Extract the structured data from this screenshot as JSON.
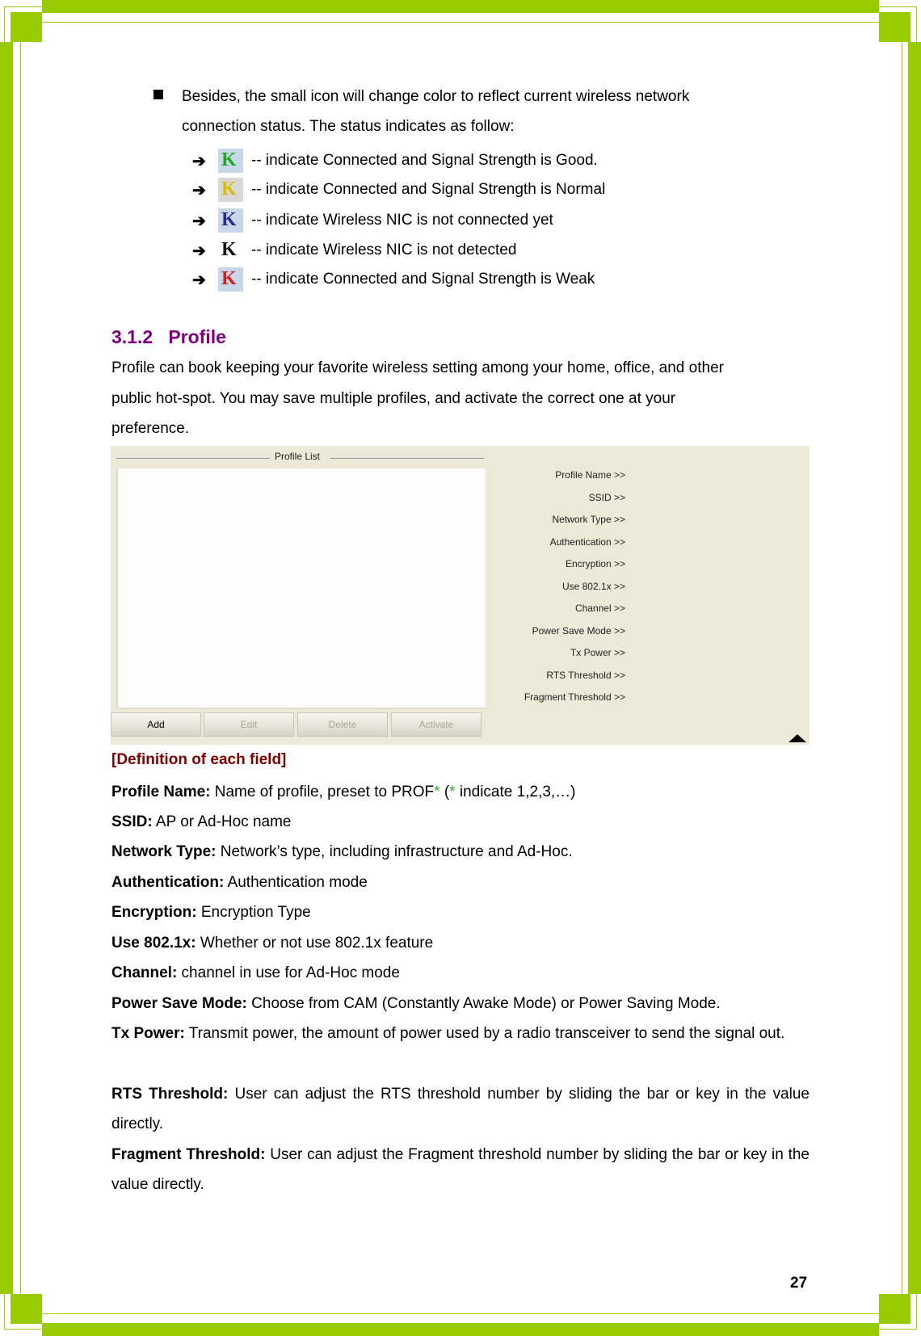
{
  "bullet": {
    "line1": "Besides, the small icon will change color to reflect current wireless network",
    "line2": "connection status. The status indicates as follow:"
  },
  "status_items": [
    {
      "icon": "tray-icon-green",
      "color": "#22aa22",
      "text": "-- indicate Connected and Signal Strength is Good."
    },
    {
      "icon": "tray-icon-yellow",
      "color": "#ddbb00",
      "text": "-- indicate Connected and Signal Strength is Normal"
    },
    {
      "icon": "tray-icon-blue-red",
      "color": "#2a2a90",
      "text": "-- indicate Wireless NIC is not connected yet"
    },
    {
      "icon": "tray-icon-black",
      "color": "#111111",
      "text": "-- indicate Wireless NIC is not detected"
    },
    {
      "icon": "tray-icon-red",
      "color": "#cc2222",
      "text": "-- indicate Connected and Signal Strength is Weak"
    }
  ],
  "section": {
    "number": "3.1.2",
    "title": "Profile",
    "intro": [
      "Profile can book keeping your favorite wireless setting among your home, office, and other",
      "public hot-spot. You may save multiple profiles, and activate the correct one at your",
      "preference."
    ]
  },
  "screenshot": {
    "list_title": "Profile List",
    "buttons": [
      {
        "label": "Add",
        "enabled": true
      },
      {
        "label": "Edit",
        "enabled": false
      },
      {
        "label": "Delete",
        "enabled": false
      },
      {
        "label": "Activate",
        "enabled": false
      }
    ],
    "fields": [
      "Profile Name >>",
      "SSID >>",
      "Network Type >>",
      "Authentication >>",
      "Encryption >>",
      "Use 802.1x >>",
      "Channel >>",
      "Power Save Mode >>",
      "Tx Power >>",
      "RTS Threshold >>",
      "Fragment Threshold >>"
    ]
  },
  "definitions": {
    "heading": "[Definition of each field]",
    "profile_name": {
      "term": "Profile Name:",
      "text1": " Name of profile, preset to PROF",
      "ast": "*",
      "text2": " (",
      "ast2": "*",
      "text3": " indicate 1,2,3,…)"
    },
    "items": [
      {
        "term": "SSID:",
        "text": " AP or Ad-Hoc name"
      },
      {
        "term": "Network Type:",
        "text": " Network’s type, including infrastructure and Ad-Hoc."
      },
      {
        "term": "Authentication:",
        "text": " Authentication mode"
      },
      {
        "term": "Encryption:",
        "text": " Encryption Type"
      },
      {
        "term": "Use 802.1x:",
        "text": " Whether or not use 802.1x feature"
      },
      {
        "term": "Channel:",
        "text": " channel in use for Ad-Hoc mode"
      },
      {
        "term": "Power Save Mode:",
        "text": " Choose from CAM (Constantly Awake Mode) or Power Saving Mode."
      },
      {
        "term": "Tx Power:",
        "text": " Transmit power, the amount of power used by a radio transceiver to send the signal out."
      },
      {
        "term": "RTS Threshold:",
        "text": " User can adjust the RTS threshold number by sliding the bar or key in the value directly."
      },
      {
        "term": "Fragment Threshold:",
        "text": " User can adjust the Fragment threshold number by sliding the bar or key in the value directly."
      }
    ]
  },
  "page_number": "27",
  "colors": {
    "border_green": "#99cc00",
    "heading_purple": "#800080",
    "definition_red": "#800000"
  }
}
